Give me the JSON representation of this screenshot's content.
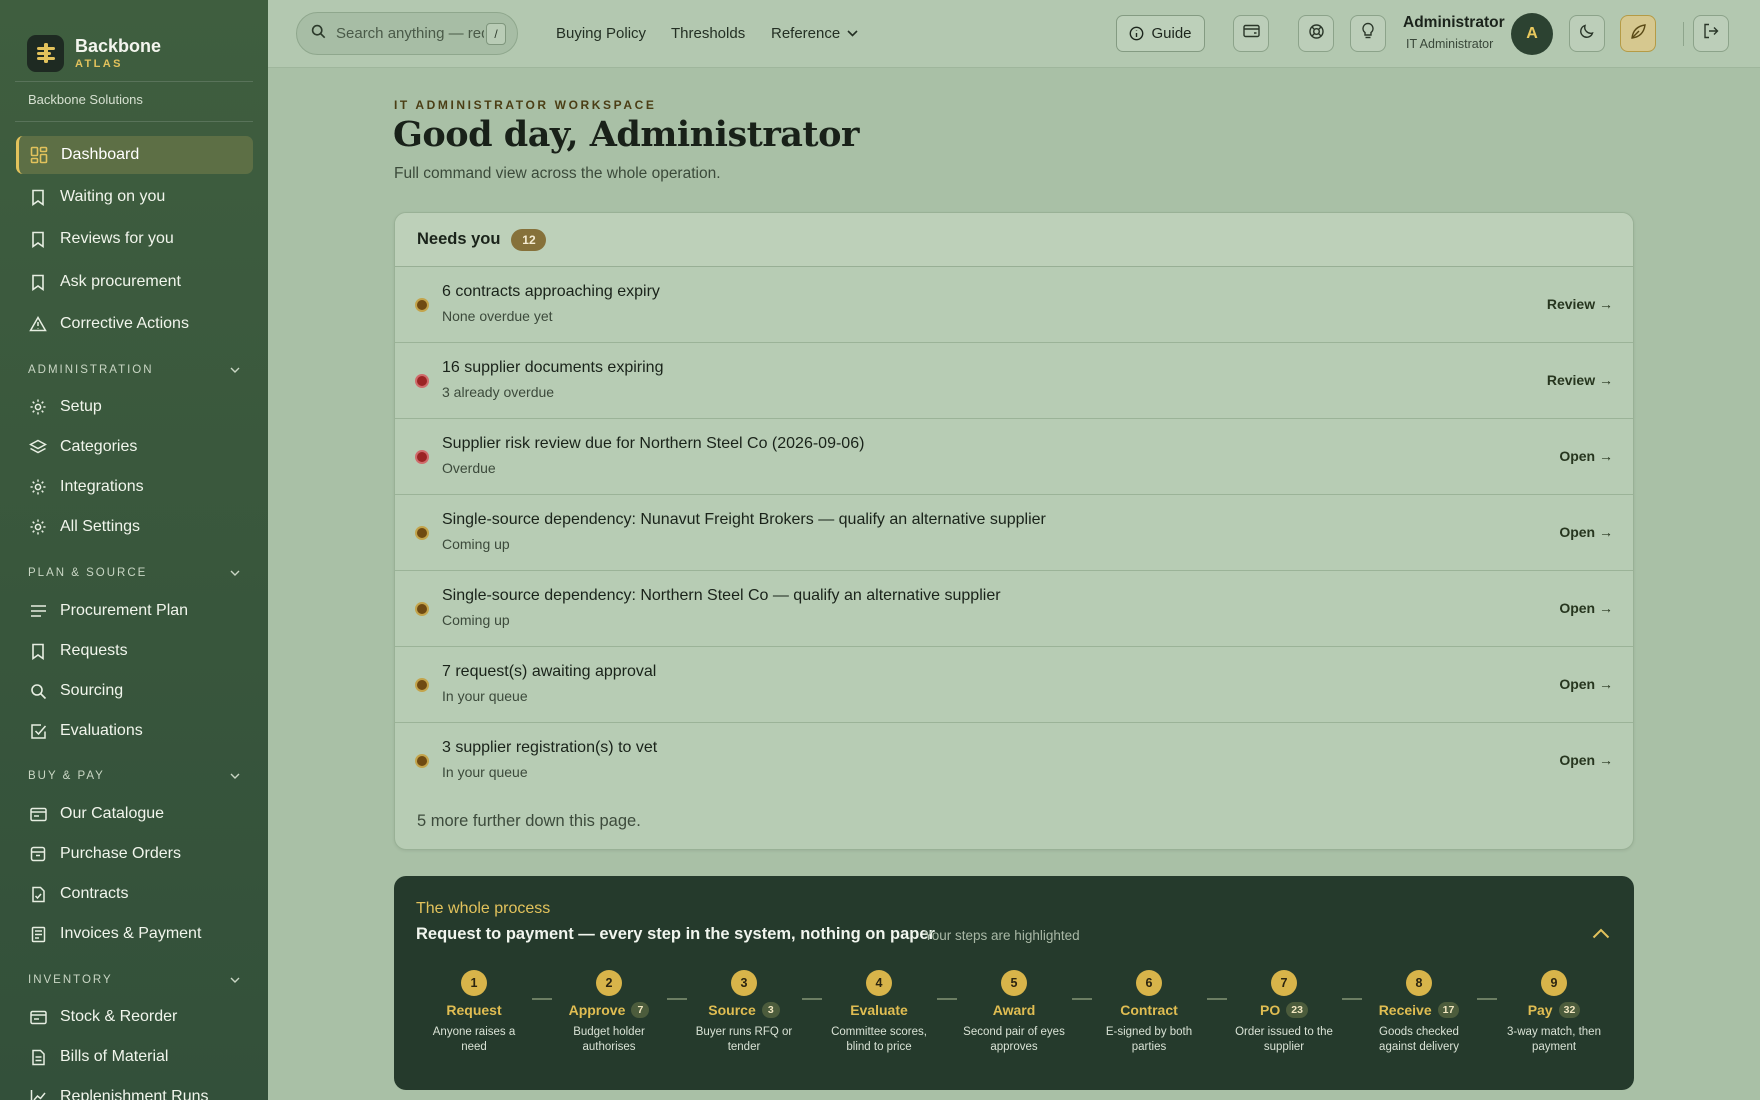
{
  "brand": {
    "name": "Backbone",
    "sub": "ATLAS",
    "org": "Backbone Solutions"
  },
  "sidebar": {
    "top_items": [
      {
        "label": "Dashboard",
        "icon": "dashboard-icon",
        "active": true
      },
      {
        "label": "Waiting on you",
        "icon": "bookmark-icon"
      },
      {
        "label": "Reviews for you",
        "icon": "bookmark-icon"
      },
      {
        "label": "Ask procurement",
        "icon": "bookmark-icon"
      },
      {
        "label": "Corrective Actions",
        "icon": "warning-icon"
      }
    ],
    "sections": [
      {
        "title": "ADMINISTRATION",
        "items": [
          {
            "label": "Setup",
            "icon": "gear-icon"
          },
          {
            "label": "Categories",
            "icon": "layers-icon"
          },
          {
            "label": "Integrations",
            "icon": "gear-icon"
          },
          {
            "label": "All Settings",
            "icon": "gear-icon"
          }
        ]
      },
      {
        "title": "PLAN & SOURCE",
        "items": [
          {
            "label": "Procurement Plan",
            "icon": "list-icon"
          },
          {
            "label": "Requests",
            "icon": "bookmark-icon"
          },
          {
            "label": "Sourcing",
            "icon": "search-icon"
          },
          {
            "label": "Evaluations",
            "icon": "checkbox-icon"
          }
        ]
      },
      {
        "title": "BUY & PAY",
        "items": [
          {
            "label": "Our Catalogue",
            "icon": "catalogue-icon"
          },
          {
            "label": "Purchase Orders",
            "icon": "box-icon"
          },
          {
            "label": "Contracts",
            "icon": "document-check-icon"
          },
          {
            "label": "Invoices & Payment",
            "icon": "invoice-icon"
          }
        ]
      },
      {
        "title": "INVENTORY",
        "items": [
          {
            "label": "Stock & Reorder",
            "icon": "catalogue-icon"
          },
          {
            "label": "Bills of Material",
            "icon": "document-icon"
          },
          {
            "label": "Replenishment Runs",
            "icon": "chart-icon"
          }
        ]
      }
    ]
  },
  "topbar": {
    "search_placeholder": "Search anything — requests, suppliers, POs",
    "search_shortcut": "/",
    "links": [
      "Buying Policy",
      "Thresholds",
      "Reference"
    ],
    "guide_label": "Guide",
    "user_name": "Administrator",
    "user_role": "IT Administrator",
    "avatar_initial": "A"
  },
  "main": {
    "eyebrow": "IT ADMINISTRATOR WORKSPACE",
    "title": "Good day, Administrator",
    "subtitle": "Full command view across the whole operation."
  },
  "needs": {
    "title": "Needs you",
    "count": "12",
    "rows": [
      {
        "title": "6 contracts approaching expiry",
        "sub": "None overdue yet",
        "action": "Review →",
        "status": "brown"
      },
      {
        "title": "16 supplier documents expiring",
        "sub": "3 already overdue",
        "action": "Review →",
        "status": "red"
      },
      {
        "title": "Supplier risk review due for Northern Steel Co (2026-09-06)",
        "sub": "Overdue",
        "action": "Open →",
        "status": "red"
      },
      {
        "title": "Single-source dependency: Nunavut Freight Brokers — qualify an alternative supplier",
        "sub": "Coming up",
        "action": "Open →",
        "status": "brown"
      },
      {
        "title": "Single-source dependency: Northern Steel Co — qualify an alternative supplier",
        "sub": "Coming up",
        "action": "Open →",
        "status": "brown"
      },
      {
        "title": "7 request(s) awaiting approval",
        "sub": "In your queue",
        "action": "Open →",
        "status": "brown"
      },
      {
        "title": "3 supplier registration(s) to vet",
        "sub": "In your queue",
        "action": "Open →",
        "status": "brown"
      }
    ],
    "footer": "5 more further down this page."
  },
  "process": {
    "eyebrow": "The whole process",
    "title": "Request to payment — every step in the system, nothing on paper",
    "hint": "Your steps are highlighted",
    "steps": [
      {
        "num": "1",
        "name": "Request",
        "badge": "",
        "desc": "Anyone raises a need"
      },
      {
        "num": "2",
        "name": "Approve",
        "badge": "7",
        "desc": "Budget holder authorises"
      },
      {
        "num": "3",
        "name": "Source",
        "badge": "3",
        "desc": "Buyer runs RFQ or tender"
      },
      {
        "num": "4",
        "name": "Evaluate",
        "badge": "",
        "desc": "Committee scores, blind to price"
      },
      {
        "num": "5",
        "name": "Award",
        "badge": "",
        "desc": "Second pair of eyes approves"
      },
      {
        "num": "6",
        "name": "Contract",
        "badge": "",
        "desc": "E-signed by both parties"
      },
      {
        "num": "7",
        "name": "PO",
        "badge": "23",
        "desc": "Order issued to the supplier"
      },
      {
        "num": "8",
        "name": "Receive",
        "badge": "17",
        "desc": "Goods checked against delivery"
      },
      {
        "num": "9",
        "name": "Pay",
        "badge": "32",
        "desc": "3-way match, then payment"
      }
    ]
  },
  "colors": {
    "sidebar": "#3f5e3f",
    "accent_gold": "#e2c25c",
    "background": "#a9c0a6",
    "process_panel": "#253a2c",
    "status_red": "#9b2424",
    "status_brown": "#6f4a12"
  }
}
